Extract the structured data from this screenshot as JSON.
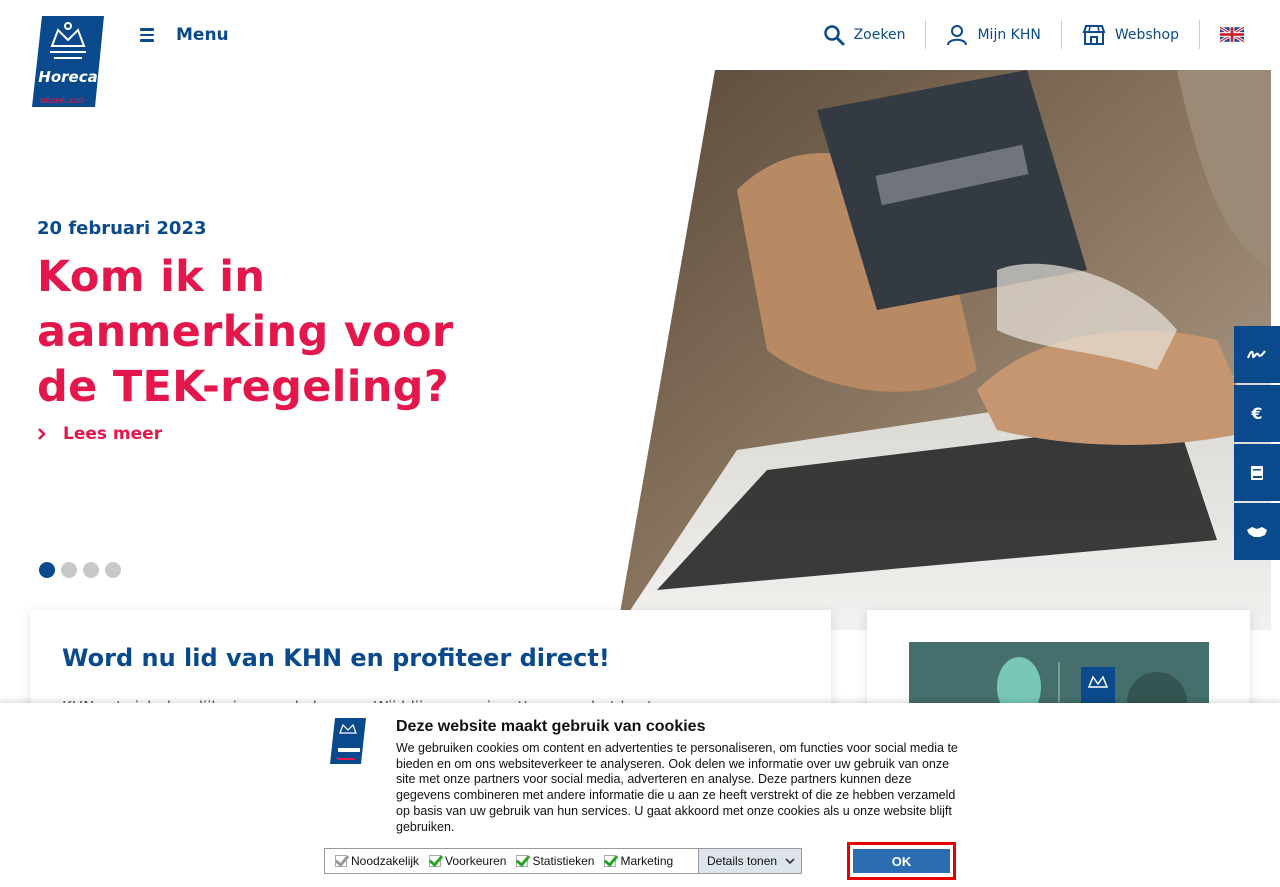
{
  "header": {
    "logo_text": "Horeca",
    "logo_subtext": "NEDERLAND",
    "menu_label": "Menu",
    "nav": [
      {
        "label": "Zoeken",
        "icon": "search-icon"
      },
      {
        "label": "Mijn KHN",
        "icon": "user-icon"
      },
      {
        "label": "Webshop",
        "icon": "shop-icon"
      }
    ],
    "language_icon": "uk-flag-icon"
  },
  "hero": {
    "date": "20 februari 2023",
    "headline": "Kom ik in aanmerking voor de TEK-regeling?",
    "read_more": "Lees meer",
    "slides_total": 4,
    "active_slide": 1
  },
  "side_tabs": [
    {
      "icon": "signature-icon",
      "glyph": "≈"
    },
    {
      "icon": "euro-icon",
      "glyph": "€"
    },
    {
      "icon": "book-icon",
      "glyph": "▮"
    },
    {
      "icon": "handshake-icon",
      "glyph": "✦"
    }
  ],
  "cards": {
    "member_title": "Word nu lid van KHN en profiteer direct!",
    "member_text": "KHN zet zich dagelijks in voor de horeca. Wij blijven ons inzetten voor het beste"
  },
  "cookie": {
    "title": "Deze website maakt gebruik van cookies",
    "text": "We gebruiken cookies om content en advertenties te personaliseren, om functies voor social media te bieden en om ons websiteverkeer te analyseren. Ook delen we informatie over uw gebruik van onze site met onze partners voor social media, adverteren en analyse. Deze partners kunnen deze gegevens combineren met andere informatie die u aan ze heeft verstrekt of die ze hebben verzameld op basis van uw gebruik van hun services. U gaat akkoord met onze cookies als u onze website blijft gebruiken.",
    "preferences": [
      {
        "label": "Noodzakelijk",
        "checked": true,
        "disabled": true
      },
      {
        "label": "Voorkeuren",
        "checked": true,
        "disabled": false
      },
      {
        "label": "Statistieken",
        "checked": true,
        "disabled": false
      },
      {
        "label": "Marketing",
        "checked": true,
        "disabled": false
      }
    ],
    "details_label": "Details tonen",
    "ok_label": "OK"
  },
  "colors": {
    "brand_blue": "#0a4a8c",
    "accent_red": "#e3174b",
    "ok_button": "#2b6cb3",
    "highlight": "#e60000"
  }
}
